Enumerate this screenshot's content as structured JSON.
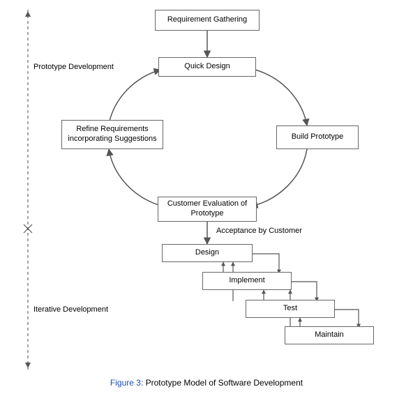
{
  "diagram": {
    "boxes": {
      "req_gathering": "Requirement Gathering",
      "quick_design": "Quick Design",
      "build_prototype": "Build Prototype",
      "customer_eval": "Customer Evaluation of Prototype",
      "refine_req": "Refine Requirements incorporating Suggestions",
      "design": "Design",
      "implement": "Implement",
      "test": "Test",
      "maintain": "Maintain"
    },
    "labels": {
      "prototype_dev": "Prototype Development",
      "iterative_dev": "Iterative Development",
      "acceptance": "Acceptance by Customer"
    },
    "caption": {
      "fig": "Figure 3:",
      "text": "Prototype Model of Software Development"
    }
  }
}
